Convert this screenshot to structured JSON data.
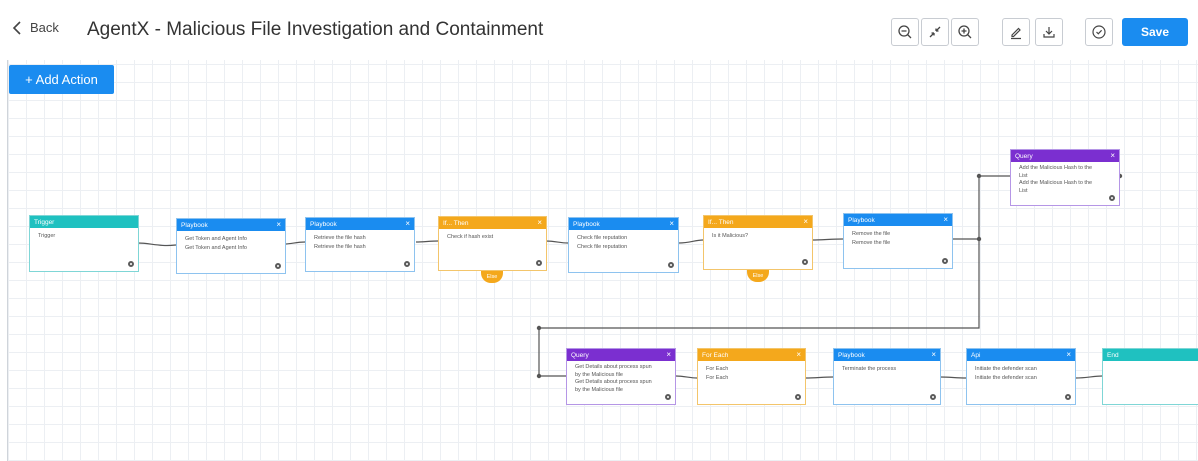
{
  "header": {
    "back_label": "Back",
    "title": "AgentX - Malicious File Investigation and Containment",
    "save_label": "Save"
  },
  "toolbar": {
    "icons": [
      "zoom-out-icon",
      "collapse-icon",
      "zoom-in-icon",
      "pencil-icon",
      "download-icon",
      "check-circle-icon"
    ]
  },
  "canvas": {
    "add_action_label": "+ Add Action"
  },
  "nodes": [
    {
      "type": "Trigger",
      "closable": false,
      "lines": [
        "Trigger"
      ]
    },
    {
      "type": "Playbook",
      "closable": true,
      "lines": [
        "Get Token and Agent Info",
        "Get Token and Agent Info"
      ]
    },
    {
      "type": "Playbook",
      "closable": true,
      "lines": [
        "Retrieve the file hash",
        "Retrieve the file hash"
      ]
    },
    {
      "type": "If... Then",
      "closable": true,
      "lines": [
        "Check if hash exist"
      ],
      "else_label": "Else"
    },
    {
      "type": "Playbook",
      "closable": true,
      "lines": [
        "Check file reputation",
        "Check file reputation"
      ]
    },
    {
      "type": "If... Then",
      "closable": true,
      "lines": [
        "Is it Malicious?"
      ],
      "else_label": "Else"
    },
    {
      "type": "Playbook",
      "closable": true,
      "lines": [
        "Remove the file",
        "Remove the file"
      ]
    },
    {
      "type": "Query",
      "closable": true,
      "lines": [
        "Add the Malicious Hash to the",
        "List",
        "Add the Malicious Hash to the",
        "List"
      ]
    },
    {
      "type": "Query",
      "closable": true,
      "lines": [
        "Get Details about process spun",
        "by the Malicious file",
        "Get Details about process spun",
        "by the Malicious file"
      ]
    },
    {
      "type": "For Each",
      "closable": true,
      "lines": [
        "For Each",
        "For Each"
      ]
    },
    {
      "type": "Playbook",
      "closable": true,
      "lines": [
        "Terminate the process"
      ]
    },
    {
      "type": "Api",
      "closable": true,
      "lines": [
        "Initiate the defender scan",
        "Initiate the defender scan"
      ]
    },
    {
      "type": "End",
      "closable": false,
      "lines": []
    }
  ],
  "colors": {
    "primary": "#1a8cf0",
    "trigger": "#1fc1c0",
    "condition": "#f4a81c",
    "query": "#7b2fd0"
  }
}
